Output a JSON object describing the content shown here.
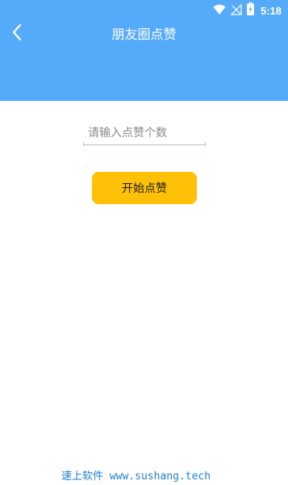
{
  "colors": {
    "header_bg": "#55aaf9",
    "button_bg": "#ffc107",
    "watermark": "#1e7fd4"
  },
  "status_bar": {
    "time": "5:18",
    "icons": [
      "wifi-icon",
      "no-signal-icon",
      "battery-charging-icon"
    ]
  },
  "header": {
    "title": "朋友圈点赞",
    "back_icon": "chevron-left-icon"
  },
  "form": {
    "like_count_placeholder": "请输入点赞个数",
    "like_count_value": "",
    "start_label": "开始点赞"
  },
  "watermark": {
    "text": "速上软件 www.sushang.tech"
  }
}
